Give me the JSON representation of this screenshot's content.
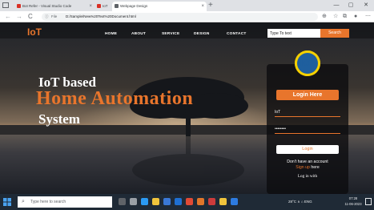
{
  "browser": {
    "tabs": [
      {
        "label": "Bot Refer - Visual Studio Code"
      },
      {
        "label": "IoT",
        "fav_color": "#d93025"
      },
      {
        "label": "Webpage Design",
        "fav_color": "#5f6368"
      }
    ],
    "new_tab": "+",
    "window_controls": {
      "minimize": "—",
      "maximize": "▢",
      "close": "✕"
    },
    "address": {
      "info_label": "ⓘ",
      "file_label": "File",
      "path": "D:/Sample/New%20Text%20Document.html"
    },
    "nav": {
      "back": "←",
      "forward": "→",
      "reload": "C"
    },
    "toolbar_icons": {
      "zoom": "🔍",
      "star": "☆",
      "extensions": "⧉",
      "profile": "●",
      "menu": "⋯"
    }
  },
  "site": {
    "brand": "IoT",
    "nav": [
      "HOME",
      "ABOUT",
      "SERVICE",
      "DESIGN",
      "CONTACT"
    ],
    "search": {
      "placeholder": "Type To text",
      "button": "Search"
    },
    "hero": {
      "line1": "IoT based",
      "line2": "Home Automation",
      "line3": "System"
    },
    "login": {
      "logo_text": "IOT",
      "title": "Login Here",
      "username_value": "IoT",
      "password_value": "••••••••",
      "button": "Login",
      "no_account": "Don't have an account",
      "signup_link": "Sign up",
      "signup_suffix": " here",
      "login_with": "Log in with"
    }
  },
  "taskbar": {
    "search_placeholder": "Type here to search",
    "search_icon": "⌕",
    "tray": "28°C  ∧  ⌂  ENG",
    "time": "07:28",
    "date": "11-06-2023",
    "apps": [
      {
        "name": "cortana",
        "color": "#5f6368"
      },
      {
        "name": "task-view",
        "color": "#9aa0a6"
      },
      {
        "name": "edge",
        "color": "#2b9af3"
      },
      {
        "name": "file-explorer",
        "color": "#f0c43c"
      },
      {
        "name": "store",
        "color": "#3a78d6"
      },
      {
        "name": "mail",
        "color": "#1f6fd1"
      },
      {
        "name": "chrome",
        "color": "#e04a35"
      },
      {
        "name": "app-orange",
        "color": "#e0762a"
      },
      {
        "name": "app-red",
        "color": "#cc3b3b"
      },
      {
        "name": "app-yellow",
        "color": "#f0c43c"
      },
      {
        "name": "app-blue",
        "color": "#2d7be0"
      }
    ]
  },
  "colors": {
    "accent": "#e8752c",
    "logo_yellow": "#f5d000",
    "logo_blue": "#1f5f9e"
  }
}
